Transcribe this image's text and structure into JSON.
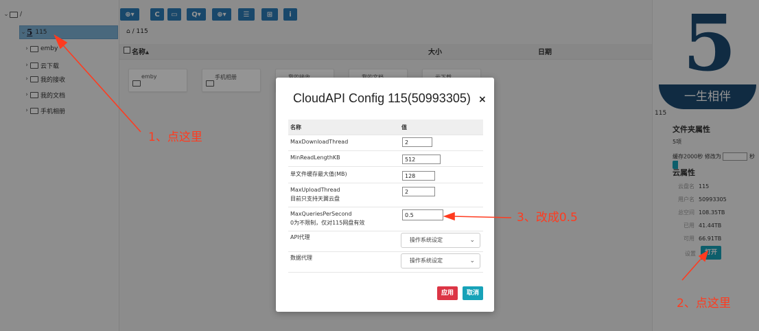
{
  "tree": {
    "root_label": "/",
    "selected_label": "115",
    "selected_icon_glyph": "5",
    "items": [
      {
        "label": "emby"
      },
      {
        "label": "云下载"
      },
      {
        "label": "我的接收"
      },
      {
        "label": "我的文档"
      },
      {
        "label": "手机相册"
      }
    ]
  },
  "toolbar": {
    "buttons": [
      {
        "name": "add-menu",
        "glyph": "⊕▾"
      },
      {
        "name": "refresh",
        "glyph": "C"
      },
      {
        "name": "monitor",
        "glyph": "▭"
      },
      {
        "name": "search-menu",
        "glyph": "Q▾"
      },
      {
        "name": "zoom-menu",
        "glyph": "⊕▾"
      },
      {
        "name": "list-view",
        "glyph": "☰"
      },
      {
        "name": "tree-view",
        "glyph": "⊞"
      },
      {
        "name": "info",
        "glyph": "i"
      }
    ]
  },
  "breadcrumb": {
    "home_glyph": "⌂",
    "path": "/ 115"
  },
  "file_header": {
    "name": "名称",
    "sort_glyph": "▴",
    "size": "大小",
    "date": "日期"
  },
  "tiles": [
    {
      "label": "emby"
    },
    {
      "label": "手机相册"
    },
    {
      "label": "我的接收"
    },
    {
      "label": "我的文档"
    },
    {
      "label": "云下载"
    }
  ],
  "right_panel": {
    "logo_number": "5",
    "logo_text": "一生相伴",
    "drive_name": "115",
    "folder_props_title": "文件夹属性",
    "item_count": "5项",
    "cache_label": "缓存2000秒",
    "modify_label": "修改为",
    "seconds_unit": "秒",
    "cloud_props_title": "云属性",
    "props": [
      {
        "key": "云盘名",
        "value": "115"
      },
      {
        "key": "用户名",
        "value": "50993305"
      },
      {
        "key": "总空间",
        "value": "108.35TB"
      },
      {
        "key": "已用",
        "value": "41.44TB"
      },
      {
        "key": "可用",
        "value": "66.91TB"
      }
    ],
    "settings_label": "设置",
    "open_button": "打开"
  },
  "modal": {
    "title": "CloudAPI Config 115(50993305)",
    "close": "×",
    "col_name": "名称",
    "col_value": "值",
    "rows": [
      {
        "name": "MaxDownloadThread",
        "note": "",
        "value": "2"
      },
      {
        "name": "MinReadLengthKB",
        "note": "",
        "value": "512"
      },
      {
        "name": "单文件缓存最大值(MB)",
        "note": "",
        "value": "128"
      },
      {
        "name": "MaxUploadThread",
        "note": "目前只支持天翼云盘",
        "value": "2"
      },
      {
        "name": "MaxQueriesPerSecond",
        "note": "0为不限制，仅对115网盘有效",
        "value": "0.5"
      }
    ],
    "api_proxy_label": "API代理",
    "api_proxy_value": "操作系统设定",
    "data_proxy_label": "数据代理",
    "data_proxy_value": "操作系统设定",
    "apply_button": "应用",
    "cancel_button": "取消"
  },
  "annotations": {
    "step1": "1、点这里",
    "step2": "2、点这里",
    "step3": "3、改成0.5"
  },
  "colors": {
    "primary": "#2b7cb8",
    "danger": "#dc3545",
    "info": "#17a2b8",
    "annotation": "#ff3b1f",
    "logo": "#1c4a73"
  }
}
